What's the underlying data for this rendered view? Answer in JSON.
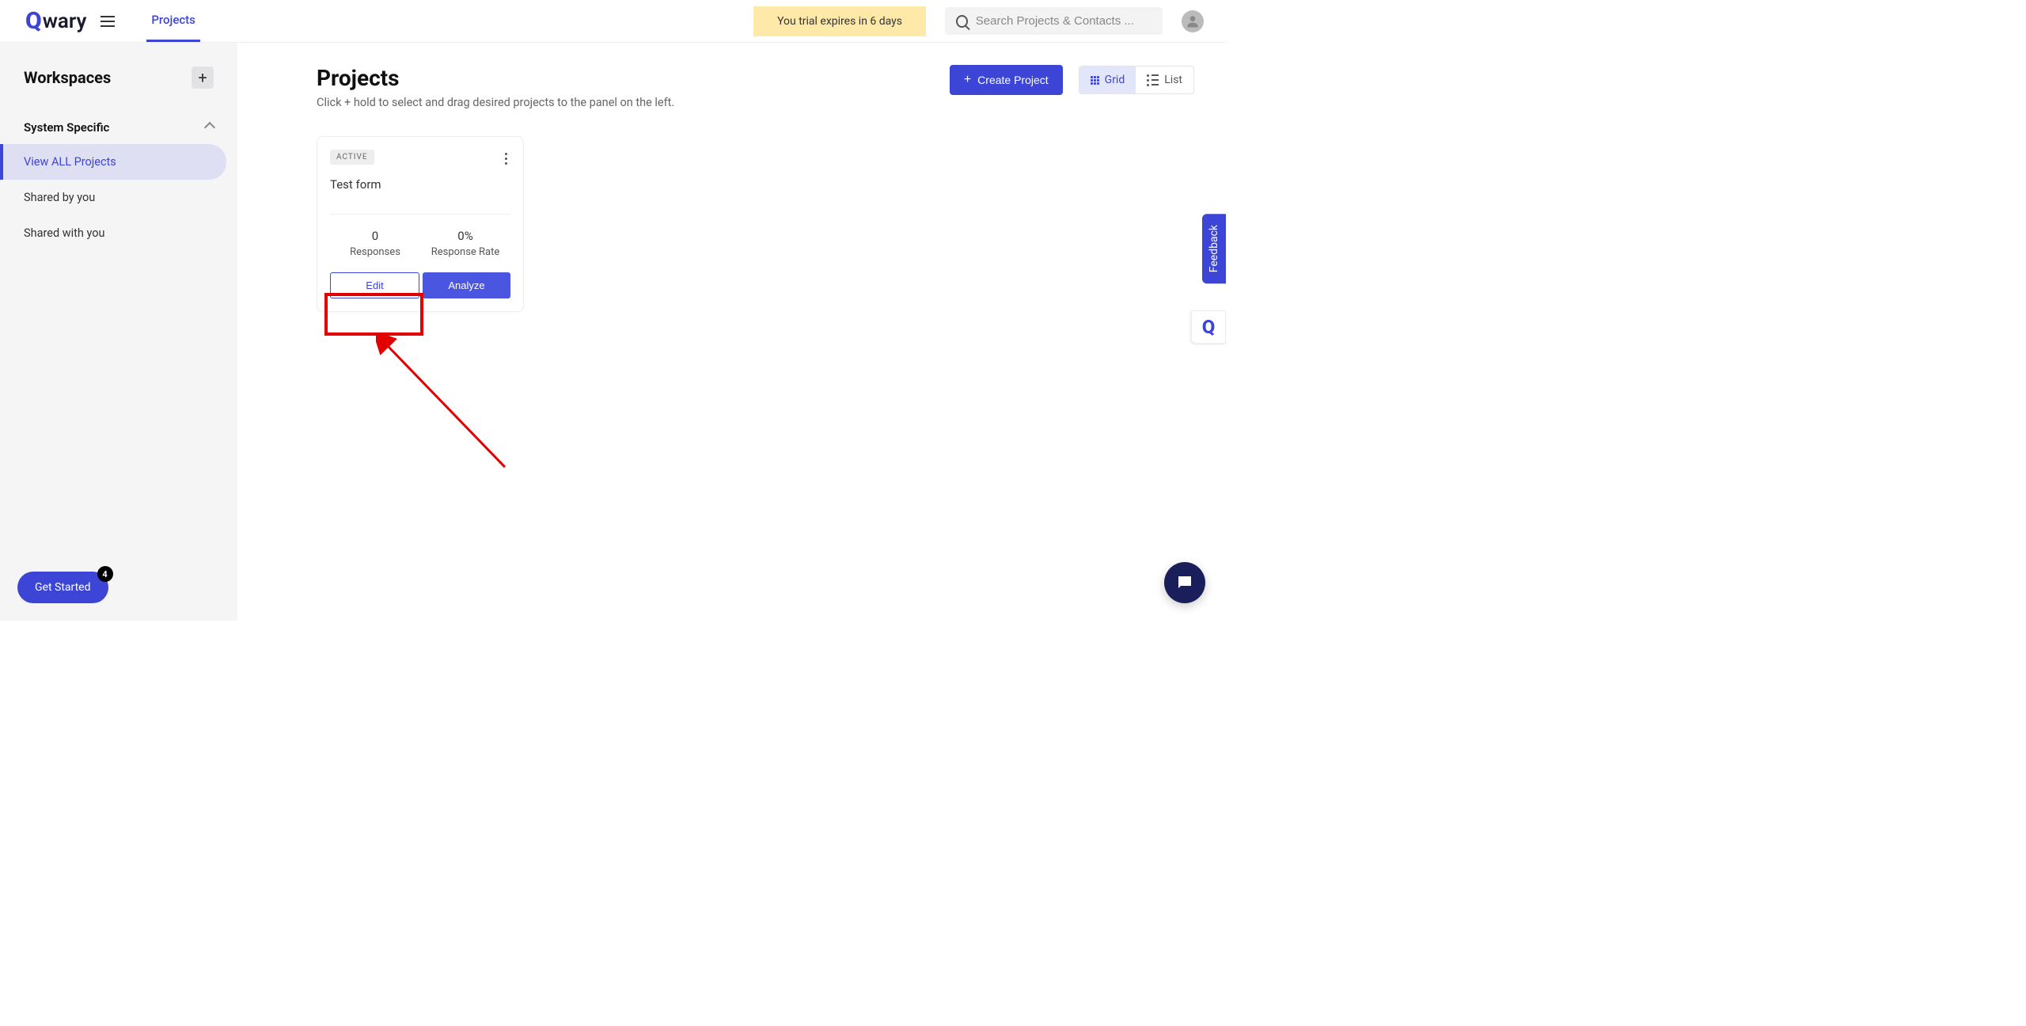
{
  "header": {
    "logo_text": "wary",
    "tab_projects": "Projects",
    "trial_banner": "You trial expires in 6 days",
    "search_placeholder": "Search Projects & Contacts ..."
  },
  "sidebar": {
    "title": "Workspaces",
    "section_label": "System Specific",
    "items": [
      {
        "label": "View ALL Projects"
      },
      {
        "label": "Shared by you"
      },
      {
        "label": "Shared with you"
      }
    ]
  },
  "main": {
    "title": "Projects",
    "subtitle": "Click + hold to select and drag desired projects to the panel on the left.",
    "create_btn": "Create Project",
    "view_grid": "Grid",
    "view_list": "List"
  },
  "card": {
    "status": "ACTIVE",
    "title": "Test form",
    "responses_val": "0",
    "responses_lbl": "Responses",
    "rate_val": "0%",
    "rate_lbl": "Response Rate",
    "edit_btn": "Edit",
    "analyze_btn": "Analyze"
  },
  "get_started": {
    "label": "Get Started",
    "badge": "4"
  },
  "feedback": {
    "label": "Feedback"
  }
}
